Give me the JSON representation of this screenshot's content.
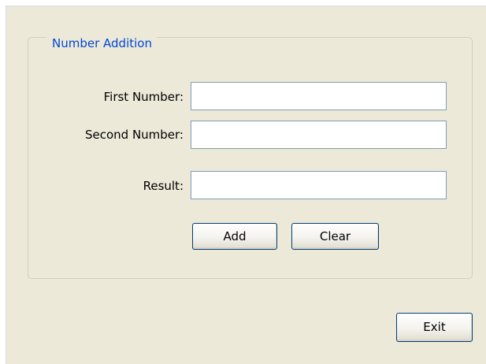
{
  "group": {
    "title": "Number Addition"
  },
  "fields": {
    "first": {
      "label": "First Number:",
      "value": ""
    },
    "second": {
      "label": "Second Number:",
      "value": ""
    },
    "result": {
      "label": "Result:",
      "value": ""
    }
  },
  "buttons": {
    "add": "Add",
    "clear": "Clear",
    "exit": "Exit"
  }
}
